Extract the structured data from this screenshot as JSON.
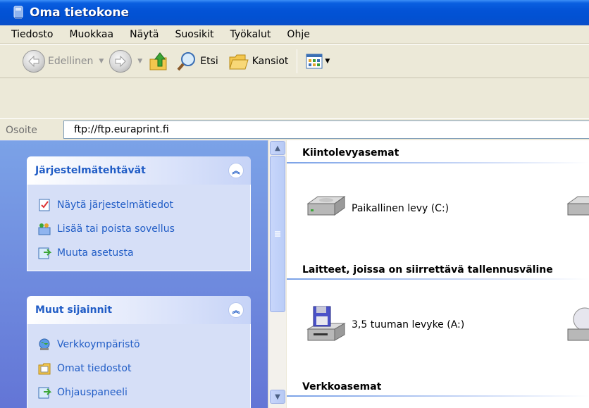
{
  "window": {
    "title": "Oma tietokone",
    "icon": "my-computer-icon"
  },
  "menu": [
    "Tiedosto",
    "Muokkaa",
    "Näytä",
    "Suosikit",
    "Työkalut",
    "Ohje"
  ],
  "toolbar": {
    "back_label": "Edellinen",
    "search_label": "Etsi",
    "folders_label": "Kansiot"
  },
  "address": {
    "label": "Osoite",
    "value": "ftp://ftp.euraprint.fi"
  },
  "tasks": {
    "system": {
      "title": "Järjestelmätehtävät",
      "items": [
        "Näytä järjestelmätiedot",
        "Lisää tai poista sovellus",
        "Muuta asetusta"
      ]
    },
    "other": {
      "title": "Muut sijainnit",
      "items": [
        "Verkkoympäristö",
        "Omat tiedostot",
        "Ohjauspaneeli"
      ]
    }
  },
  "content": {
    "groups": [
      {
        "title": "Kiintolevyasemat",
        "items": [
          "Paikallinen levy (C:)"
        ]
      },
      {
        "title": "Laitteet, joissa on siirrettävä tallennusväline",
        "items": [
          "3,5 tuuman levyke (A:)"
        ]
      },
      {
        "title": "Verkkoasemat",
        "items": []
      }
    ]
  },
  "colors": {
    "titlebar": "#0353d6",
    "task_link": "#215dc6",
    "pane": "#7ba2e7"
  }
}
